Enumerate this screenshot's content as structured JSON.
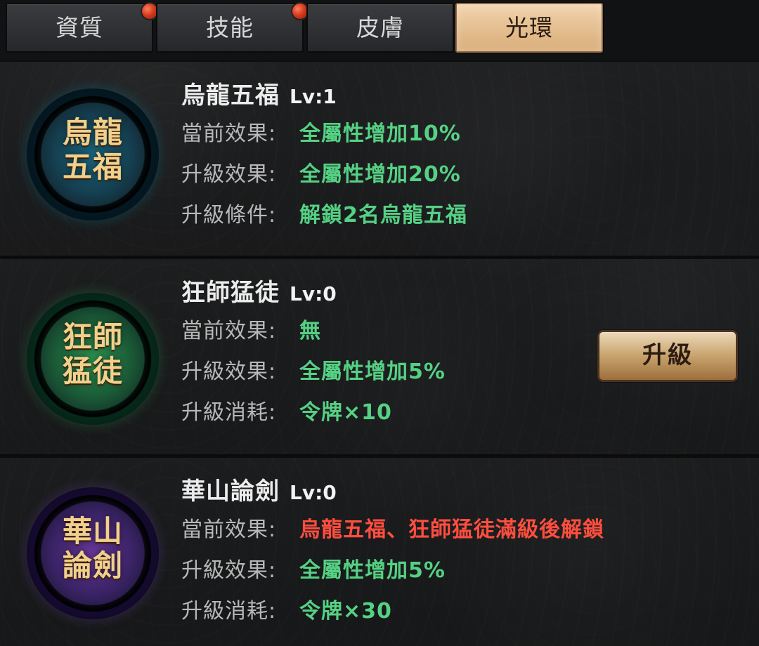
{
  "tabs": [
    {
      "label": "資質",
      "notification": true
    },
    {
      "label": "技能",
      "notification": true
    },
    {
      "label": "皮膚",
      "notification": false
    },
    {
      "label": "光環",
      "notification": false,
      "active": true
    }
  ],
  "rows": [
    {
      "badge_text": "烏龍\n五福",
      "name": "烏龍五福",
      "level": "Lv:1",
      "stats": [
        {
          "label": "當前效果:",
          "value": "全屬性增加10%",
          "color": "#55d184"
        },
        {
          "label": "升級效果:",
          "value": "全屬性增加20%",
          "color": "#55d184"
        },
        {
          "label": "升級條件:",
          "value": "解鎖2名烏龍五福",
          "color": "#55d184"
        }
      ]
    },
    {
      "badge_text": "狂師\n猛徒",
      "name": "狂師猛徒",
      "level": "Lv:0",
      "stats": [
        {
          "label": "當前效果:",
          "value": "無",
          "color": "#55d184"
        },
        {
          "label": "升級效果:",
          "value": "全屬性增加5%",
          "color": "#55d184"
        },
        {
          "label": "升級消耗:",
          "value": "令牌×10",
          "color": "#55d184"
        }
      ],
      "button": "升級"
    },
    {
      "badge_text": "華山\n論劍",
      "name": "華山論劍",
      "level": "Lv:0",
      "stats": [
        {
          "label": "當前效果:",
          "value": "烏龍五福、狂師猛徒滿級後解鎖",
          "color": "#ff4e3f"
        },
        {
          "label": "升級效果:",
          "value": "全屬性增加5%",
          "color": "#55d184"
        },
        {
          "label": "升級消耗:",
          "value": "令牌×30",
          "color": "#55d184"
        }
      ]
    }
  ]
}
